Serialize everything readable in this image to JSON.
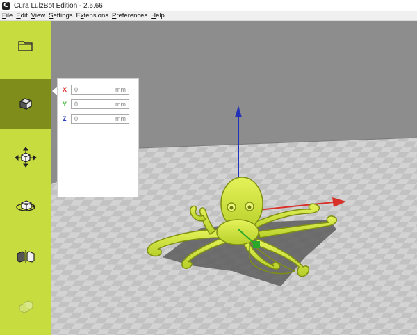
{
  "window": {
    "title": "Cura LulzBot Edition - 2.6.66",
    "icon_letter": "C"
  },
  "menu": [
    {
      "key": "F",
      "rest": "ile"
    },
    {
      "key": "E",
      "rest": "dit"
    },
    {
      "key": "V",
      "rest": "iew"
    },
    {
      "key": "S",
      "rest": "ettings"
    },
    {
      "pre": "E",
      "key": "x",
      "rest": "tensions"
    },
    {
      "key": "P",
      "rest": "references"
    },
    {
      "key": "H",
      "rest": "elp"
    }
  ],
  "toolbar": {
    "items": [
      {
        "name": "open-file",
        "icon": "folder-icon",
        "active": false
      },
      {
        "name": "scale",
        "icon": "scale-icon",
        "active": true
      },
      {
        "name": "move",
        "icon": "move-icon",
        "active": false
      },
      {
        "name": "rotate",
        "icon": "rotate-icon",
        "active": false
      },
      {
        "name": "mirror",
        "icon": "mirror-icon",
        "active": false
      },
      {
        "name": "per-model-settings",
        "icon": "per-model-settings-icon",
        "active": false
      }
    ]
  },
  "position_panel": {
    "x": {
      "label": "X",
      "value": "0",
      "unit": "mm",
      "color": "#e0312a"
    },
    "y": {
      "label": "Y",
      "value": "0",
      "unit": "mm",
      "color": "#3fbf3f"
    },
    "z": {
      "label": "Z",
      "value": "0",
      "unit": "mm",
      "color": "#2a3fc8"
    }
  },
  "colors": {
    "sidebar": "#c7dc3e",
    "sidebar_active": "#7f8e1b",
    "model": "#d4ea3c",
    "axis_x": "#d9302a",
    "axis_y": "#2231b8",
    "axis_z": "#2aa82a"
  }
}
